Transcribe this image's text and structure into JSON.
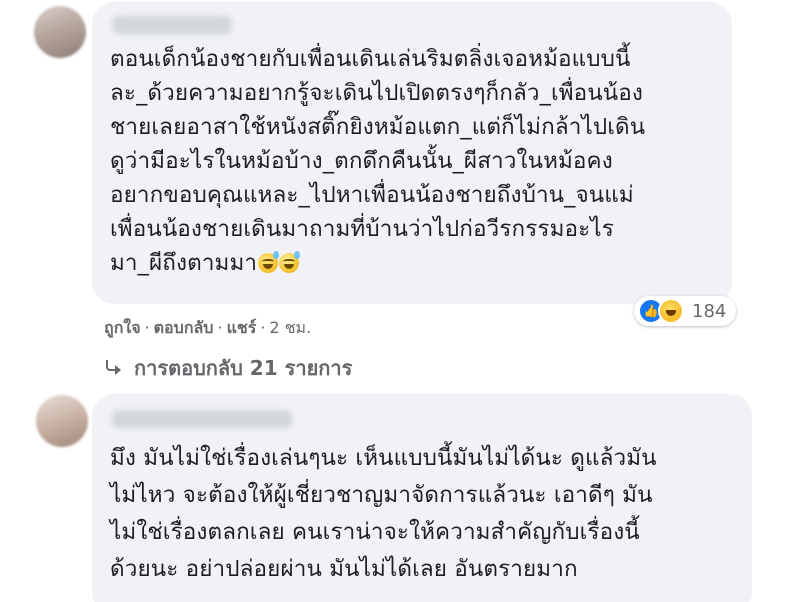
{
  "comment1": {
    "author": "",
    "lines": [
      "ตอนเด็กน้องชายกับเพื่อนเดินเล่นริมตลิ่งเจอหม้อแบบนี้",
      "ละ_ด้วยความอยากรู้จะเดินไปเปิดตรงๆก็กลัว_เพื่อนน้อง",
      "ชายเลยอาสาใช้หนังสติ๊กยิงหม้อแตก_แต่ก็ไม่กล้าไปเดิน",
      "ดูว่ามีอะไรในหม้อบ้าง_ตกดึกคืนนั้น_ผีสาวในหม้อคง",
      "อยากขอบคุณแหละ_ไปหาเพื่อนน้องชายถึงบ้าน_จนแม่",
      "เพื่อนน้องชายเดินมาถามที่บ้านว่าไปก่อวีรกรรมอะไร",
      "มา_ผีถึงตามมา"
    ],
    "emojis": [
      "grinning-sweat-face",
      "grinning-sweat-face"
    ],
    "reaction_icons": [
      "like-icon",
      "haha-icon"
    ],
    "reaction_count": "184",
    "actions": {
      "like": "ถูกใจ",
      "reply": "ตอบกลับ",
      "share": "แชร์",
      "time": "2 ชม."
    },
    "replies_link": "การตอบกลับ 21 รายการ"
  },
  "comment2": {
    "author": "",
    "lines": [
      "มึง มันไม่ใช่เรื่องเล่นๆนะ เห็นแบบนี้มันไม่ได้นะ ดูแล้วมัน",
      "ไม่ไหว จะต้องให้ผู้เชี่ยวชาญมาจัดการแล้วนะ เอาดีๆ มัน",
      "ไม่ใช่เรื่องตลกเลย คนเราน่าจะให้ความสำคัญกับเรื่องนี้",
      "ด้วยนะ อย่าปล่อยผ่าน มันไม่ได้เลย อันตรายมาก"
    ]
  },
  "colors": {
    "bubble": "#f0f2f5",
    "text": "#1c1e21",
    "secondary_text": "#65676b",
    "like_blue": "#1877f2"
  }
}
